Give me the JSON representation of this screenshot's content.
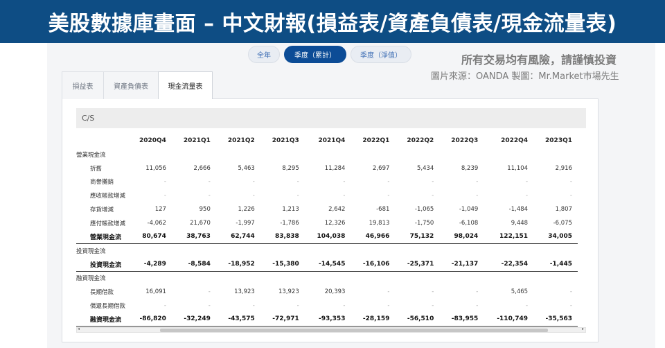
{
  "banner": {
    "title": "美股數據庫畫面 – 中文財報(損益表/資產負債表/現金流量表)"
  },
  "period_toggle": {
    "options": [
      "全年",
      "季度（累計）",
      "季度（淨值）"
    ],
    "selected": "季度（累計）"
  },
  "disclaimer": "所有交易均有風險，請謹慎投資",
  "source": "圖片來源：OANDA 製圖：Mr.Market市場先生",
  "statement_tabs": {
    "items": [
      "損益表",
      "資產負債表",
      "現金流量表"
    ],
    "selected": "現金流量表"
  },
  "table": {
    "caption": "C/S",
    "columns": [
      "2020Q4",
      "2021Q1",
      "2021Q2",
      "2021Q3",
      "2021Q4",
      "2022Q1",
      "2022Q2",
      "2022Q3",
      "2022Q4",
      "2023Q1"
    ],
    "rows": [
      {
        "label": "營業現金流",
        "kind": "section",
        "values": [
          "",
          "",
          "",
          "",
          "",
          "",
          "",
          "",
          "",
          ""
        ]
      },
      {
        "label": "折舊",
        "kind": "item",
        "values": [
          "11,056",
          "2,666",
          "5,463",
          "8,295",
          "11,284",
          "2,697",
          "5,434",
          "8,239",
          "11,104",
          "2,916"
        ]
      },
      {
        "label": "商譽攤銷",
        "kind": "item",
        "values": [
          "-",
          "-",
          "-",
          "-",
          "-",
          "-",
          "-",
          "-",
          "-",
          "-"
        ]
      },
      {
        "label": "應收帳款增減",
        "kind": "item",
        "values": [
          "-",
          "-",
          "-",
          "-",
          "-",
          "-",
          "-",
          "-",
          "-",
          "-"
        ]
      },
      {
        "label": "存貨增減",
        "kind": "item",
        "values": [
          "127",
          "950",
          "1,226",
          "1,213",
          "2,642",
          "-681",
          "-1,065",
          "-1,049",
          "-1,484",
          "1,807"
        ]
      },
      {
        "label": "應付帳款增減",
        "kind": "item",
        "values": [
          "-4,062",
          "21,670",
          "-1,997",
          "-1,786",
          "12,326",
          "19,813",
          "-1,750",
          "-6,108",
          "9,448",
          "-6,075"
        ]
      },
      {
        "label": "營業現金流",
        "kind": "total",
        "values": [
          "80,674",
          "38,763",
          "62,744",
          "83,838",
          "104,038",
          "46,966",
          "75,132",
          "98,024",
          "122,151",
          "34,005"
        ]
      },
      {
        "label": "投資現金流",
        "kind": "section",
        "values": [
          "",
          "",
          "",
          "",
          "",
          "",
          "",
          "",
          "",
          ""
        ]
      },
      {
        "label": "投資現金流",
        "kind": "total",
        "values": [
          "-4,289",
          "-8,584",
          "-18,952",
          "-15,380",
          "-14,545",
          "-16,106",
          "-25,371",
          "-21,137",
          "-22,354",
          "-1,445"
        ]
      },
      {
        "label": "融資現金流",
        "kind": "section",
        "values": [
          "",
          "",
          "",
          "",
          "",
          "",
          "",
          "",
          "",
          ""
        ]
      },
      {
        "label": "長期借款",
        "kind": "item",
        "values": [
          "16,091",
          "-",
          "13,923",
          "13,923",
          "20,393",
          "-",
          "-",
          "-",
          "5,465",
          "-"
        ]
      },
      {
        "label": "償還長期借款",
        "kind": "item",
        "values": [
          "-",
          "-",
          "-",
          "-",
          "-",
          "-",
          "-",
          "-",
          "-",
          "-"
        ]
      },
      {
        "label": "融資現金流",
        "kind": "total",
        "values": [
          "-86,820",
          "-32,249",
          "-43,575",
          "-72,971",
          "-93,353",
          "-28,159",
          "-56,510",
          "-83,955",
          "-110,749",
          "-35,563"
        ]
      }
    ]
  },
  "scrollbar": {
    "left_arrow": "◂",
    "right_arrow": "▸"
  }
}
